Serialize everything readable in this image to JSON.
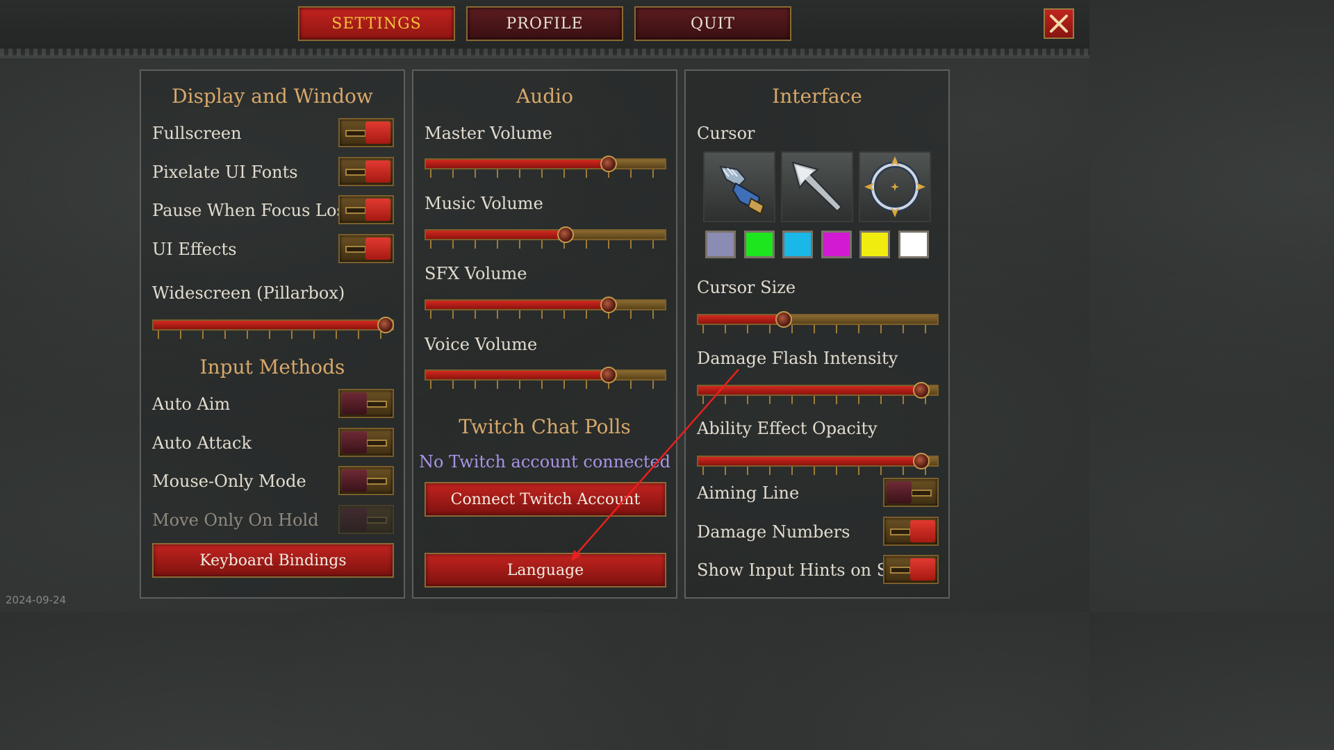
{
  "nav": {
    "settings": "SETTINGS",
    "profile": "PROFILE",
    "quit": "QUIT"
  },
  "display": {
    "title": "Display and Window",
    "fullscreen": "Fullscreen",
    "pixelate": "Pixelate UI Fonts",
    "pause": "Pause When Focus Lost",
    "ui_effects": "UI Effects",
    "widescreen": "Widescreen (Pillarbox)",
    "widescreen_value": 1.0
  },
  "input": {
    "title": "Input Methods",
    "auto_aim": "Auto Aim",
    "auto_attack": "Auto Attack",
    "mouse_only": "Mouse-Only Mode",
    "move_hold": "Move Only On Hold",
    "keyboard_bindings": "Keyboard Bindings"
  },
  "audio": {
    "title": "Audio",
    "master": "Master Volume",
    "master_value": 0.78,
    "music": "Music Volume",
    "music_value": 0.59,
    "sfx": "SFX Volume",
    "sfx_value": 0.78,
    "voice": "Voice Volume",
    "voice_value": 0.78
  },
  "twitch": {
    "title": "Twitch Chat Polls",
    "status": "No Twitch account connected",
    "connect": "Connect Twitch Account",
    "language": "Language"
  },
  "interface": {
    "title": "Interface",
    "cursor": "Cursor",
    "cursor_size": "Cursor Size",
    "cursor_size_value": 0.35,
    "damage_flash": "Damage Flash Intensity",
    "damage_flash_value": 0.96,
    "ability_opacity": "Ability Effect Opacity",
    "ability_opacity_value": 0.96,
    "aiming_line": "Aiming Line",
    "damage_numbers": "Damage Numbers",
    "input_hints": "Show Input Hints on Start"
  },
  "swatch_colors": [
    "#8a8cb4",
    "#1ee61e",
    "#1ab8e8",
    "#d21ad2",
    "#f0ec10",
    "#ffffff"
  ],
  "date": "2024-09-24"
}
